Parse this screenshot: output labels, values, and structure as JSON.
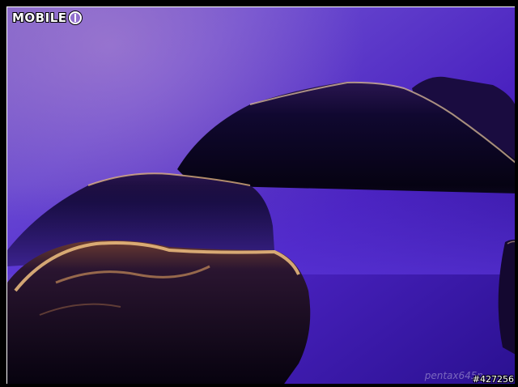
{
  "logo": {
    "text": "MOBILE",
    "suffix_icon": "mobile01-01-icon"
  },
  "watermark": {
    "text": "pentax645n"
  },
  "photo_id": {
    "text": "#427256"
  },
  "colors": {
    "mist": "#3d1aa8",
    "mist_light": "#8a6ad8",
    "highlight": "#f0c080",
    "rock": "#0c0620"
  }
}
